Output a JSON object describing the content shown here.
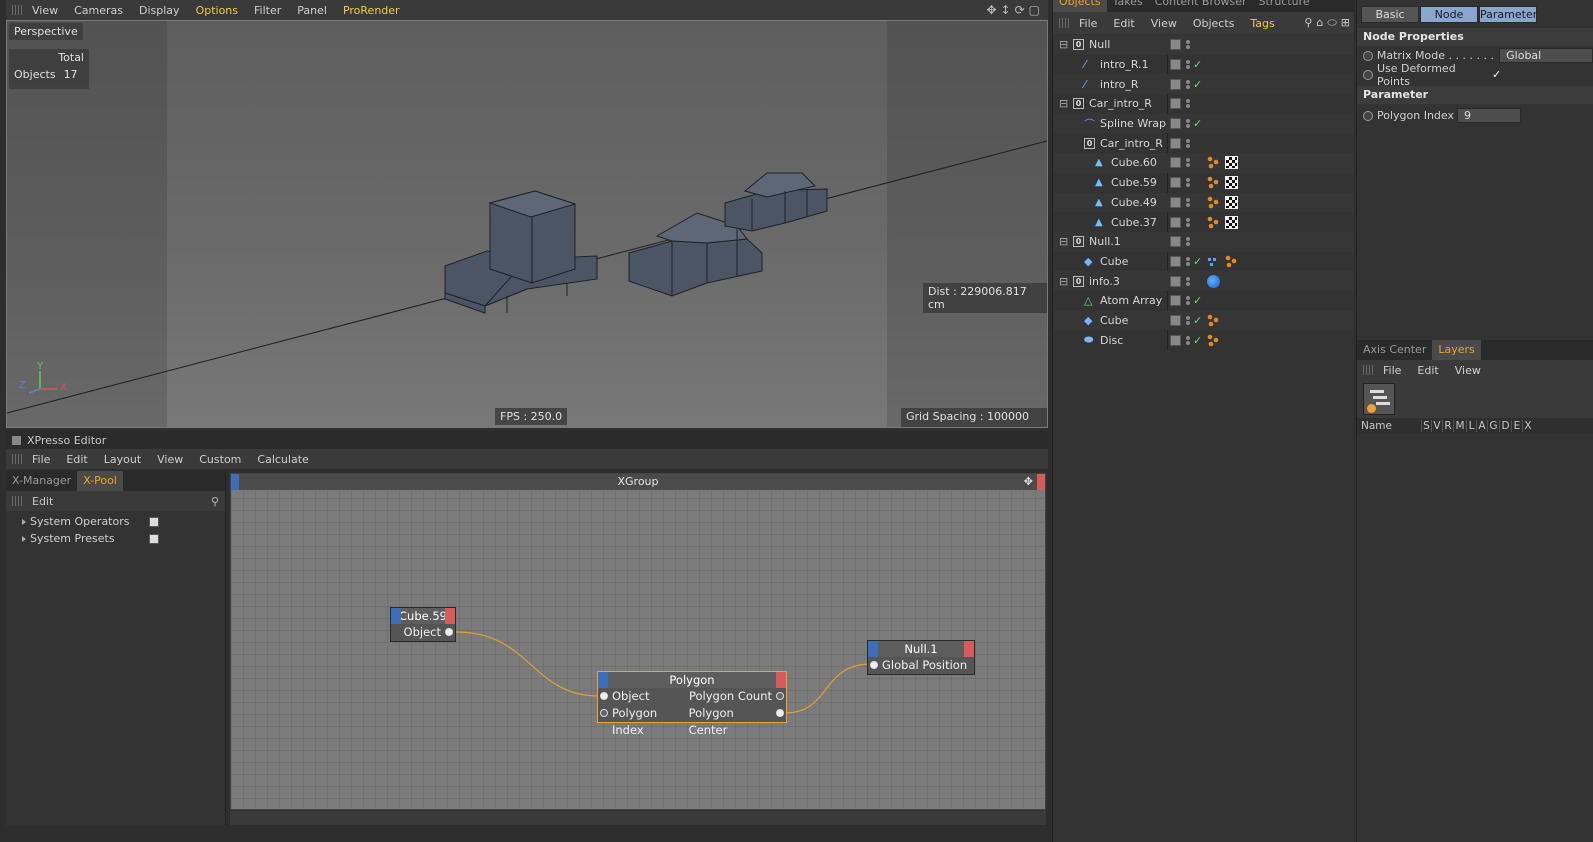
{
  "viewport_menu": {
    "items": [
      "View",
      "Cameras",
      "Display",
      "Options",
      "Filter",
      "Panel",
      "ProRender"
    ],
    "highlight": "Options"
  },
  "viewport": {
    "camera": "Perspective",
    "stats_header": "Total",
    "stats_label": "Objects",
    "stats_value": "17",
    "dist": "Dist : 229006.817 cm",
    "fps": "FPS : 250.0",
    "grid_spacing": "Grid Spacing : 100000 cm",
    "axis_y": "Y",
    "axis_x": "X",
    "axis_z": "Z"
  },
  "xpresso": {
    "title": "XPresso Editor",
    "menu": [
      "File",
      "Edit",
      "Layout",
      "View",
      "Custom",
      "Calculate"
    ],
    "tabs": [
      "X-Manager",
      "X-Pool"
    ],
    "active_tab": "X-Pool",
    "pool_edit": "Edit",
    "pool_items": [
      "System Operators",
      "System Presets"
    ],
    "group_title": "XGroup",
    "nodes": {
      "cube59": {
        "title": "Cube.59",
        "out": "Object"
      },
      "polygon": {
        "title": "Polygon",
        "in1": "Object",
        "in2": "Polygon Index",
        "out1": "Polygon Count",
        "out2": "Polygon Center"
      },
      "null1": {
        "title": "Null.1",
        "in1": "Global Position"
      }
    }
  },
  "object_manager": {
    "tabs": [
      "Objects",
      "Takes",
      "Content Browser",
      "Structure"
    ],
    "menu": [
      "File",
      "Edit",
      "View",
      "Objects",
      "Tags"
    ],
    "rows": [
      {
        "name": "Null",
        "indent": 0
      },
      {
        "name": "intro_R.1",
        "indent": 1
      },
      {
        "name": "intro_R",
        "indent": 1
      },
      {
        "name": "Car_intro_R",
        "indent": 0
      },
      {
        "name": "Spline Wrap",
        "indent": 1
      },
      {
        "name": "Car_intro_R",
        "indent": 1
      },
      {
        "name": "Cube.60",
        "indent": 2
      },
      {
        "name": "Cube.59",
        "indent": 2
      },
      {
        "name": "Cube.49",
        "indent": 2
      },
      {
        "name": "Cube.37",
        "indent": 2
      },
      {
        "name": "Null.1",
        "indent": 0
      },
      {
        "name": "Cube",
        "indent": 1
      },
      {
        "name": "info.3",
        "indent": 0
      },
      {
        "name": "Atom Array",
        "indent": 1
      },
      {
        "name": "Cube",
        "indent": 1
      },
      {
        "name": "Disc",
        "indent": 1
      }
    ]
  },
  "attributes": {
    "buttons": [
      "Basic",
      "Node",
      "Parameter"
    ],
    "section_node": "Node Properties",
    "matrix_mode_label": "Matrix Mode . . . . . . .",
    "matrix_mode_value": "Global",
    "deformed_label": "Use Deformed Points",
    "deformed_value": "✓",
    "section_param": "Parameter",
    "poly_index_label": "Polygon Index",
    "poly_index_value": "9"
  },
  "layers": {
    "tabs": [
      "Axis Center",
      "Layers"
    ],
    "active_tab": "Layers",
    "menu": [
      "File",
      "Edit",
      "View"
    ],
    "columns": [
      "Name",
      "S",
      "V",
      "R",
      "M",
      "L",
      "A",
      "G",
      "D",
      "E",
      "X"
    ]
  },
  "colors": {
    "accent": "#f0a030",
    "menu_highlight": "#f2c94c",
    "wire": "#e0a030",
    "selected_button": "#8aa6cf",
    "port_in": "#3b6fb8",
    "port_out": "#d65b5b"
  },
  "icons": [
    "grip-icon",
    "move-icon",
    "rotate-icon",
    "search-icon",
    "home-icon",
    "null-icon",
    "spline-icon",
    "cube-icon",
    "disc-icon",
    "atom-icon",
    "phong-tag-icon",
    "checker-tag-icon",
    "check-icon",
    "layers-icon"
  ]
}
